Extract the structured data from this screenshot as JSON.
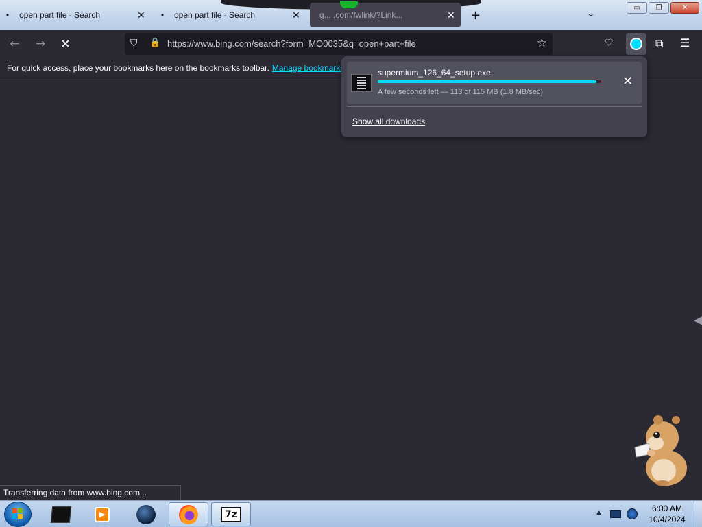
{
  "tabs": [
    {
      "dot": "•",
      "title": "open part file - Search"
    },
    {
      "dot": "•",
      "title": "open part file - Search"
    },
    {
      "title": "g... .com/fwlink/?Link..."
    }
  ],
  "tab_close_glyph": "✕",
  "new_tab_glyph": "+",
  "tab_list_glyph": "⌄",
  "window_buttons": {
    "minimize": "▭",
    "restore": "❐",
    "close": "✕"
  },
  "nav": {
    "back_glyph": "←",
    "forward_glyph": "→",
    "stop_glyph": "✕",
    "url": "https://www.bing.com/search?form=MO0035&q=open+part+file",
    "shield_glyph": "⛉",
    "lock_glyph": "🔒",
    "star_glyph": "☆",
    "pocket_glyph": "♡",
    "extensions_glyph": "⧉",
    "menu_glyph": "☰"
  },
  "bookmarks_bar": {
    "message": "For quick access, place your bookmarks here on the bookmarks toolbar.",
    "manage_link": "Manage bookmarks..."
  },
  "downloads_panel": {
    "file_name": "supermium_126_64_setup.exe",
    "status": "A few seconds left — 113 of 115 MB (1.8 MB/sec)",
    "progress_fraction": 0.98,
    "cancel_glyph": "✕",
    "show_all_label": "Show all downloads"
  },
  "status_text": "Transferring data from www.bing.com...",
  "edge_glyph": "◀",
  "taskbar": {
    "apps": [
      "start",
      "3d-cube",
      "vlc",
      "globe",
      "firefox",
      "7-zip"
    ],
    "sevenzip_label": "7z",
    "vlc_glyph": "▶",
    "tray_up_glyph": "▲",
    "time": "6:00 AM",
    "date": "10/4/2024"
  },
  "colors": {
    "accent": "#00ddff",
    "page_bg": "#2b2a33",
    "panel_bg": "#42414d"
  }
}
